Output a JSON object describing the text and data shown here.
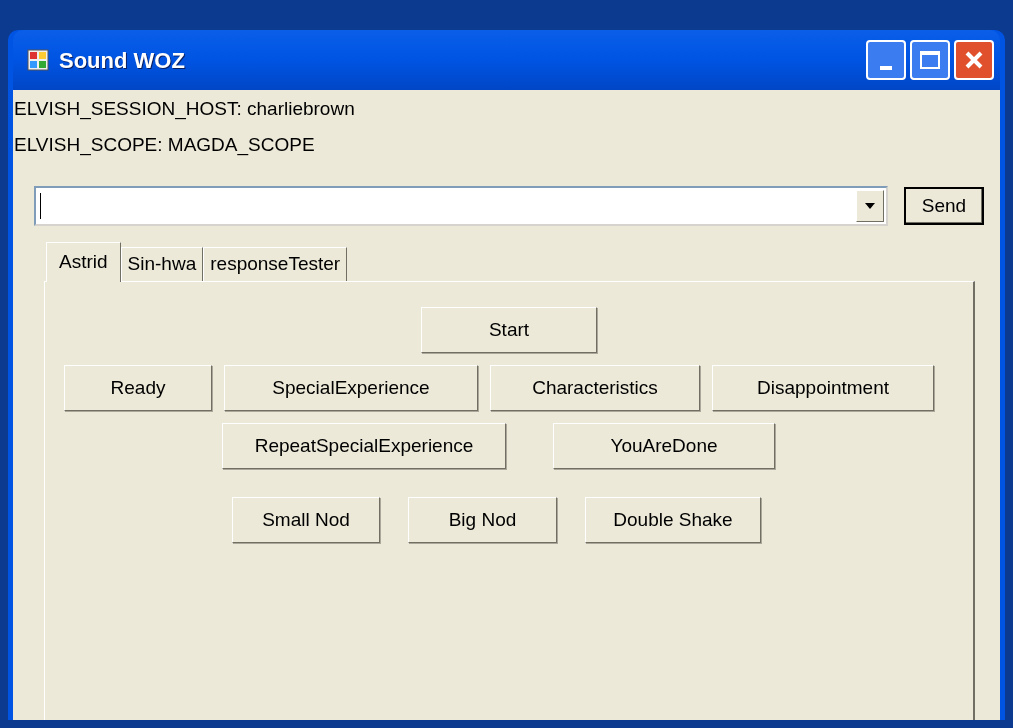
{
  "window": {
    "title": "Sound WOZ"
  },
  "info_lines": [
    "ELVISH_SESSION_HOST: charliebrown",
    "ELVISH_SCOPE: MAGDA_SCOPE"
  ],
  "send_button": "Send",
  "tabs": [
    {
      "label": "Astrid",
      "selected": true
    },
    {
      "label": "Sin-hwa",
      "selected": false
    },
    {
      "label": "responseTester",
      "selected": false
    }
  ],
  "button_rows": [
    [
      "Start"
    ],
    [
      "Ready",
      "SpecialExperience",
      "Characteristics",
      "Disappointment"
    ],
    [
      "RepeatSpecialExperience",
      "YouAreDone"
    ],
    [
      "Small Nod",
      "Big Nod",
      "Double Shake"
    ]
  ]
}
